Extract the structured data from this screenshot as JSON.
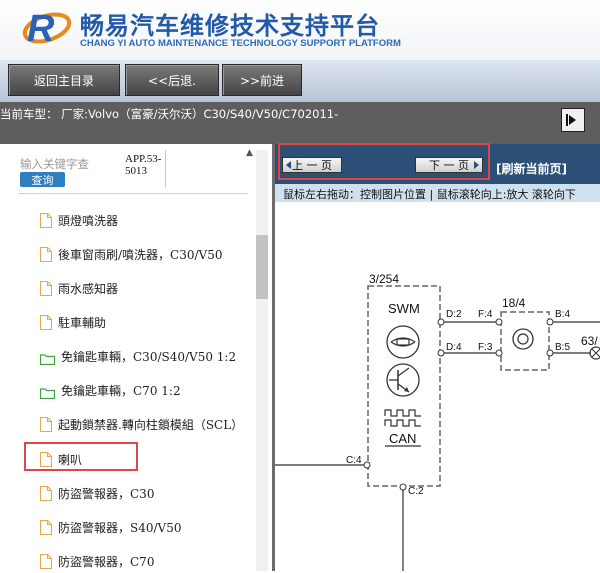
{
  "header": {
    "title_cn": "畅易汽车维修技术支持平台",
    "title_en": "CHANG YI AUTO MAINTENANCE TECHNOLOGY SUPPORT PLATFORM"
  },
  "nav": {
    "home": "返回主目录",
    "back": "<<后退.",
    "forward": ">>前进"
  },
  "vehicle": {
    "text": "当前车型：  厂家:Volvo（富豪/沃尔沃）C30/S40/V50/C702011-"
  },
  "search": {
    "label": "输入关键字查",
    "button": "查询",
    "app_code": "APP.53-5013"
  },
  "tree": {
    "items": [
      {
        "label": "頭燈噴洗器",
        "icon": "document-icon"
      },
      {
        "label": "後車窗雨刷/噴洗器，C30/V50",
        "icon": "document-icon"
      },
      {
        "label": "雨水感知器",
        "icon": "document-icon"
      },
      {
        "label": "駐車輔助",
        "icon": "document-icon"
      },
      {
        "label": "免鑰匙車輛，C30/S40/V50 1:2",
        "icon": "folder-icon"
      },
      {
        "label": "免鑰匙車輛，C70 1:2",
        "icon": "folder-icon"
      },
      {
        "label": "起動鎖禁器.轉向柱鎖模組（SCL）",
        "icon": "document-icon"
      },
      {
        "label": "喇叭",
        "icon": "document-icon"
      },
      {
        "label": "防盜警報器，C30",
        "icon": "document-icon"
      },
      {
        "label": "防盜警報器，S40/V50",
        "icon": "document-icon"
      },
      {
        "label": "防盜警報器，C70",
        "icon": "document-icon"
      }
    ]
  },
  "viewer": {
    "prev": "上 一 页",
    "next": "下 一 页",
    "refresh": "[刷新当前页]",
    "hint": "鼠标左右拖动：控制图片位置 | 鼠标滚轮向上:放大  滚轮向下"
  },
  "diagram": {
    "module_id": "3/254",
    "module_name": "SWM",
    "can_label": "CAN",
    "part_id": "18/4",
    "part_id2": "63/",
    "pins": {
      "d2": "D:2",
      "d4": "D:4",
      "f4": "F:4",
      "f3": "F:3",
      "b4": "B:4",
      "b5": "B:5",
      "c4": "C:4",
      "c2": "C:2"
    }
  },
  "colors": {
    "title_blue": "#2259a8",
    "nav_button": "#555555",
    "vehicle_bar": "#5e5e5e",
    "viewer_toolbar": "#2c4f78",
    "highlight_red": "#e04646",
    "query_blue": "#2f7ec0",
    "hint_bar": "#cfe0ef"
  }
}
